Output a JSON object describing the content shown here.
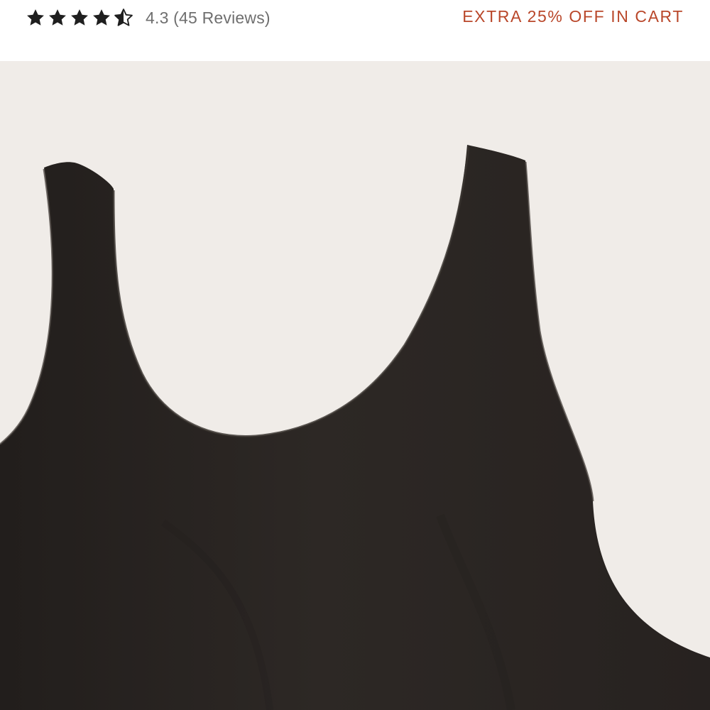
{
  "rating": {
    "value": 4.3,
    "max_stars": 5,
    "text": "4.3 (45 Reviews)",
    "star_color": "#1f1f1f",
    "star_icons": [
      "star-icon",
      "star-icon",
      "star-icon",
      "star-icon",
      "half-star-icon"
    ]
  },
  "promo": {
    "text": "EXTRA 25% OFF IN CART",
    "color": "#b9472a"
  },
  "product_image": {
    "subject": "black scoop-neck tank top",
    "background_color": "#f0ece8",
    "garment_color": "#2b2623"
  }
}
